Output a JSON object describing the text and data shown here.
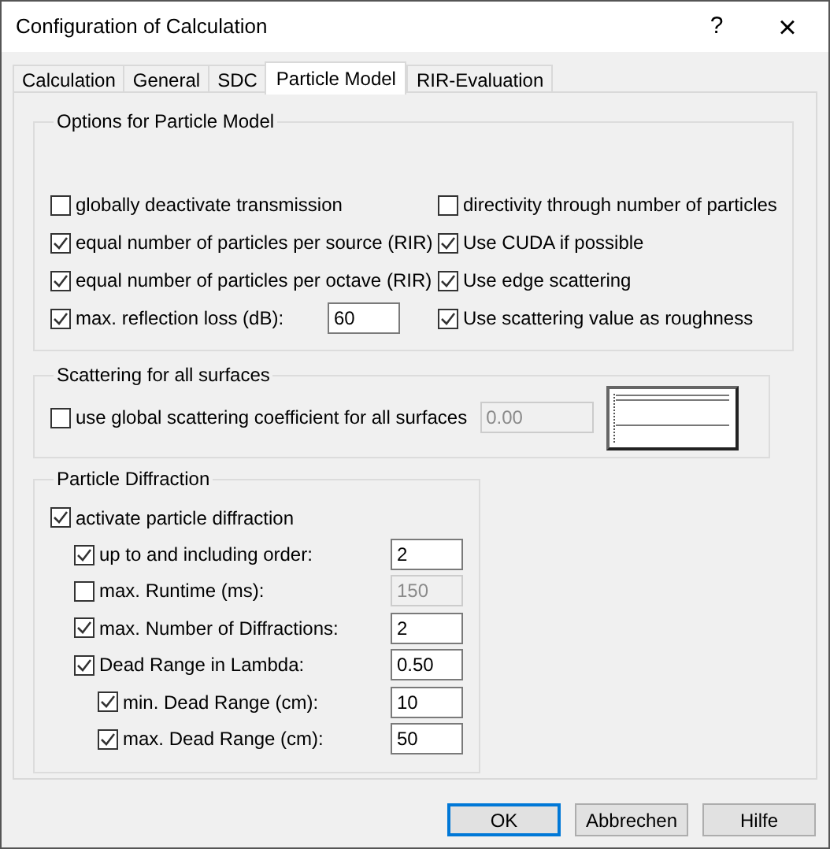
{
  "window": {
    "title": "Configuration of Calculation",
    "help": "?",
    "close": "×"
  },
  "tabs": [
    {
      "label": "Calculation",
      "selected": false
    },
    {
      "label": "General",
      "selected": false
    },
    {
      "label": "SDC",
      "selected": false
    },
    {
      "label": "Particle Model",
      "selected": true
    },
    {
      "label": "RIR-Evaluation",
      "selected": false
    }
  ],
  "options_group": {
    "title": "Options for Particle Model",
    "left": [
      {
        "label": "globally deactivate transmission",
        "checked": false
      },
      {
        "label": "equal number of particles per source (RIR)",
        "checked": true
      },
      {
        "label": "equal number of particles per octave (RIR)",
        "checked": true
      },
      {
        "label": "max. reflection loss (dB):",
        "checked": true,
        "field": {
          "value": "60",
          "disabled": false
        }
      }
    ],
    "right": [
      {
        "label": "directivity through number of particles",
        "checked": false
      },
      {
        "label": "Use CUDA if possible",
        "checked": true
      },
      {
        "label": "Use edge scattering",
        "checked": true
      },
      {
        "label": "Use scattering value as roughness",
        "checked": true
      }
    ]
  },
  "scattering_group": {
    "title": "Scattering for all surfaces",
    "item": {
      "label": "use global scattering coefficient for all surfaces",
      "checked": false,
      "field": {
        "value": "0.00",
        "disabled": true
      }
    }
  },
  "diffraction_group": {
    "title": "Particle Diffraction",
    "items": [
      {
        "label": "activate particle diffraction",
        "checked": true,
        "children": [
          {
            "label": "up to and including order:",
            "checked": true,
            "field": {
              "value": "2",
              "disabled": false
            }
          },
          {
            "label": "max. Runtime (ms):",
            "checked": false,
            "field": {
              "value": "150",
              "disabled": true
            }
          },
          {
            "label": "max. Number of Diffractions:",
            "checked": true,
            "field": {
              "value": "2",
              "disabled": false
            }
          },
          {
            "label": "Dead Range in Lambda:",
            "checked": true,
            "field": {
              "value": "0.50",
              "disabled": false
            },
            "children": [
              {
                "label": "min. Dead Range (cm):",
                "checked": true,
                "field": {
                  "value": "10",
                  "disabled": false
                }
              },
              {
                "label": "max. Dead Range (cm):",
                "checked": true,
                "field": {
                  "value": "50",
                  "disabled": false
                }
              }
            ]
          }
        ]
      }
    ]
  },
  "buttons": [
    {
      "label": "OK",
      "default": true
    },
    {
      "label": "Abbrechen",
      "default": false
    },
    {
      "label": "Hilfe",
      "default": false
    }
  ]
}
